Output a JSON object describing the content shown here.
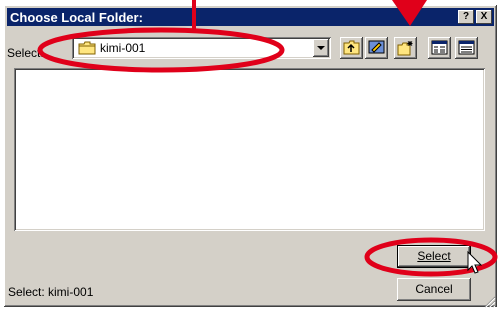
{
  "window": {
    "title": "Choose Local Folder:",
    "help_button": "?",
    "close_button": "X"
  },
  "location": {
    "label": "Select:",
    "current_folder": "kimi-001"
  },
  "toolbar": {
    "icons": [
      "up-folder-icon",
      "desktop-icon",
      "new-folder-icon",
      "list-view-icon",
      "details-view-icon"
    ]
  },
  "buttons": {
    "select": "Select",
    "cancel": "Cancel"
  },
  "status": {
    "text": "Select: kimi-001"
  },
  "annotation_color": "#e0001a"
}
